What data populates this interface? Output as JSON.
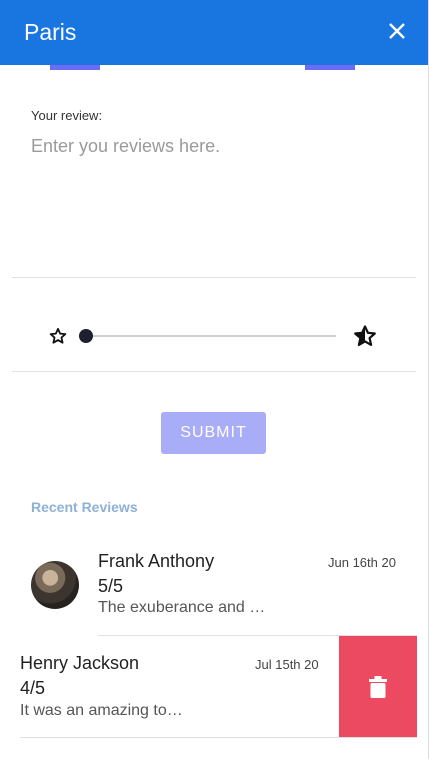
{
  "header": {
    "title": "Paris",
    "close_icon": "close-icon"
  },
  "form": {
    "label": "Your review:",
    "placeholder": "Enter you reviews here.",
    "rating_min_icon": "star-outline-icon",
    "rating_max_icon": "star-half-icon",
    "slider_value_fraction": 0,
    "submit_label": "SUBMIT"
  },
  "recent": {
    "title": "Recent Reviews",
    "reviews": [
      {
        "name": "Frank Anthony",
        "date": "Jun 16th 20",
        "rating": "5/5",
        "text": "The exuberance and …"
      },
      {
        "name": "Henry Jackson",
        "date": "Jul 15th 20",
        "rating": "4/5",
        "text": "It was an amazing to…"
      }
    ],
    "delete_icon": "trash-icon"
  },
  "colors": {
    "header": "#1976e0",
    "submit": "#a9acf7",
    "delete": "#ec4a60",
    "section_title": "#8fb1d6"
  }
}
